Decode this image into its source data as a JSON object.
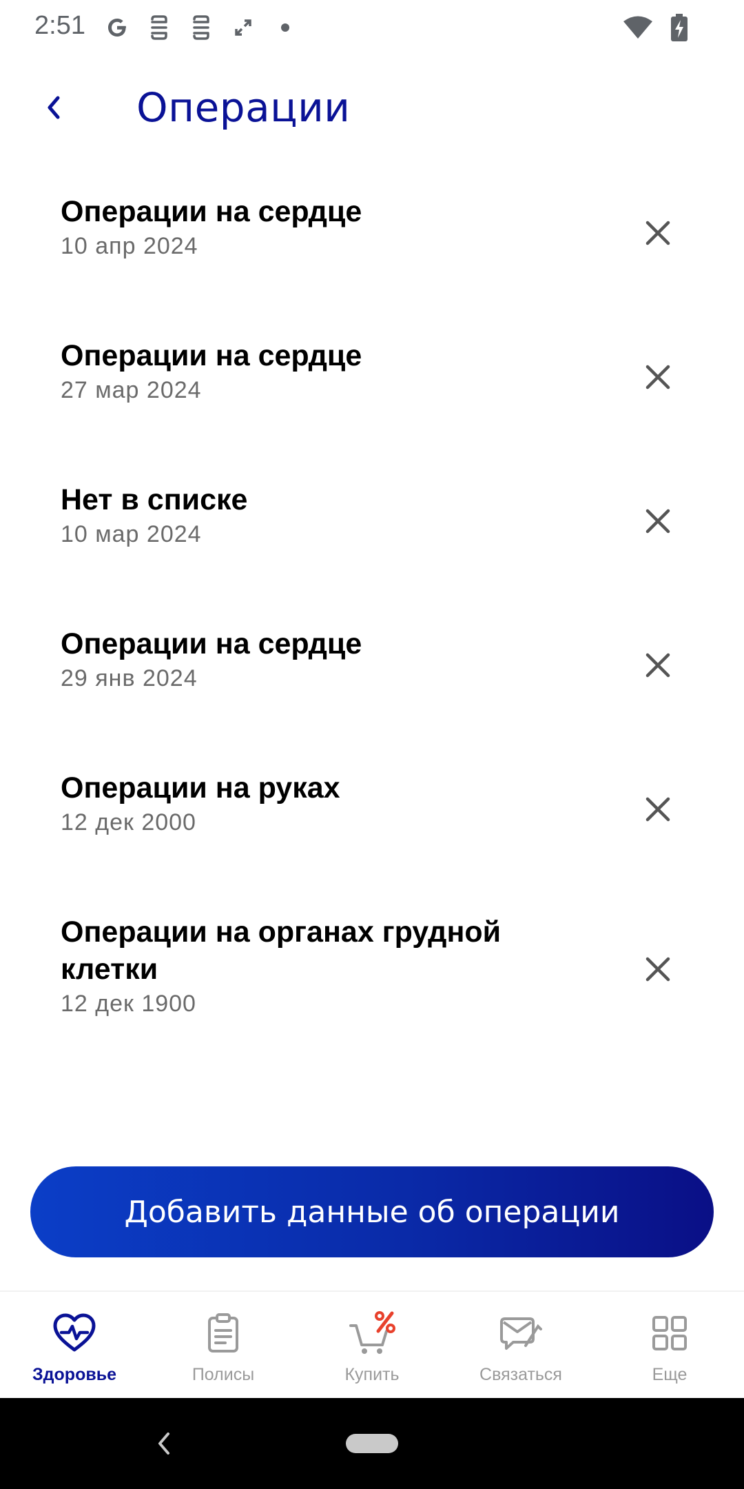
{
  "status_bar": {
    "time": "2:51",
    "left_icons": [
      "google-icon",
      "app-notification-icon",
      "app-notification-icon",
      "expand-icon",
      "dot-icon"
    ],
    "right_icons": [
      "wifi-icon",
      "battery-charging-icon"
    ]
  },
  "header": {
    "title": "Операции",
    "back_icon": "chevron-left-icon"
  },
  "operations": [
    {
      "title": "Операции на сердце",
      "date": "10 апр 2024"
    },
    {
      "title": "Операции на сердце",
      "date": "27 мар 2024"
    },
    {
      "title": "Нет в списке",
      "date": "10 мар 2024"
    },
    {
      "title": "Операции на сердце",
      "date": "29 янв 2024"
    },
    {
      "title": "Операции на руках",
      "date": "12 дек 2000"
    },
    {
      "title": "Операции на органах грудной клетки",
      "date": "12 дек 1900"
    }
  ],
  "add_button": {
    "label": "Добавить данные об операции"
  },
  "bottom_nav": {
    "items": [
      {
        "label": "Здоровье",
        "icon": "heart-pulse-icon",
        "active": true
      },
      {
        "label": "Полисы",
        "icon": "clipboard-icon",
        "active": false
      },
      {
        "label": "Купить",
        "icon": "cart-percent-icon",
        "active": false
      },
      {
        "label": "Связаться",
        "icon": "message-icon",
        "active": false
      },
      {
        "label": "Еще",
        "icon": "grid-icon",
        "active": false
      }
    ]
  },
  "colors": {
    "accent": "#0a1296",
    "button_gradient_start": "#0b3ec7",
    "button_gradient_end": "#0a0f86",
    "inactive": "#9a9a9a",
    "sale_red": "#e8412c"
  }
}
